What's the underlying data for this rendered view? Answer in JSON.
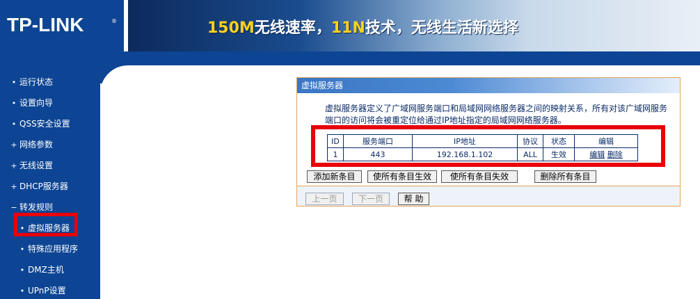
{
  "header": {
    "logo": "TP-LINK",
    "logo_reg": "®",
    "slogan_a": "150M",
    "slogan_b": "无线速率，",
    "slogan_c": "11N",
    "slogan_d": "技术，无线生活新选择"
  },
  "nav": {
    "items": [
      {
        "bullet": "•",
        "label": "运行状态"
      },
      {
        "bullet": "•",
        "label": "设置向导"
      },
      {
        "bullet": "•",
        "label": "QSS安全设置"
      },
      {
        "bullet": "+",
        "label": "网络参数"
      },
      {
        "bullet": "+",
        "label": "无线设置"
      },
      {
        "bullet": "+",
        "label": "DHCP服务器"
      },
      {
        "bullet": "−",
        "label": "转发规则"
      },
      {
        "bullet": "•",
        "label": "虚拟服务器"
      },
      {
        "bullet": "•",
        "label": "特殊应用程序"
      },
      {
        "bullet": "•",
        "label": "DMZ主机"
      },
      {
        "bullet": "•",
        "label": "UPnP设置"
      }
    ],
    "active_color": "#e8000a"
  },
  "panel": {
    "title": "虚拟服务器",
    "description": "虚拟服务器定义了广域网服务端口和局域网网络服务器之间的映射关系，所有对该广域网服务端口的访问将会被重定位给通过IP地址指定的局域网网络服务器。",
    "table": {
      "headers": [
        "ID",
        "服务端口",
        "IP地址",
        "协议",
        "状态",
        "编辑"
      ],
      "rows": [
        {
          "id": "1",
          "port": "443",
          "ip": "192.168.1.102",
          "protocol": "ALL",
          "status": "生效",
          "edit": "编辑",
          "delete": "删除"
        }
      ]
    },
    "buttons": {
      "add": "添加新条目",
      "enable_all": "使所有条目生效",
      "disable_all": "使所有条目失效",
      "delete_all": "删除所有条目",
      "prev": "上一页",
      "next": "下一页",
      "help": "帮 助"
    }
  },
  "colors": {
    "nav_bg": "#0d4594",
    "highlight": "#e8000a",
    "panel_border": "#e2a45a",
    "text": "#0a2a66"
  }
}
